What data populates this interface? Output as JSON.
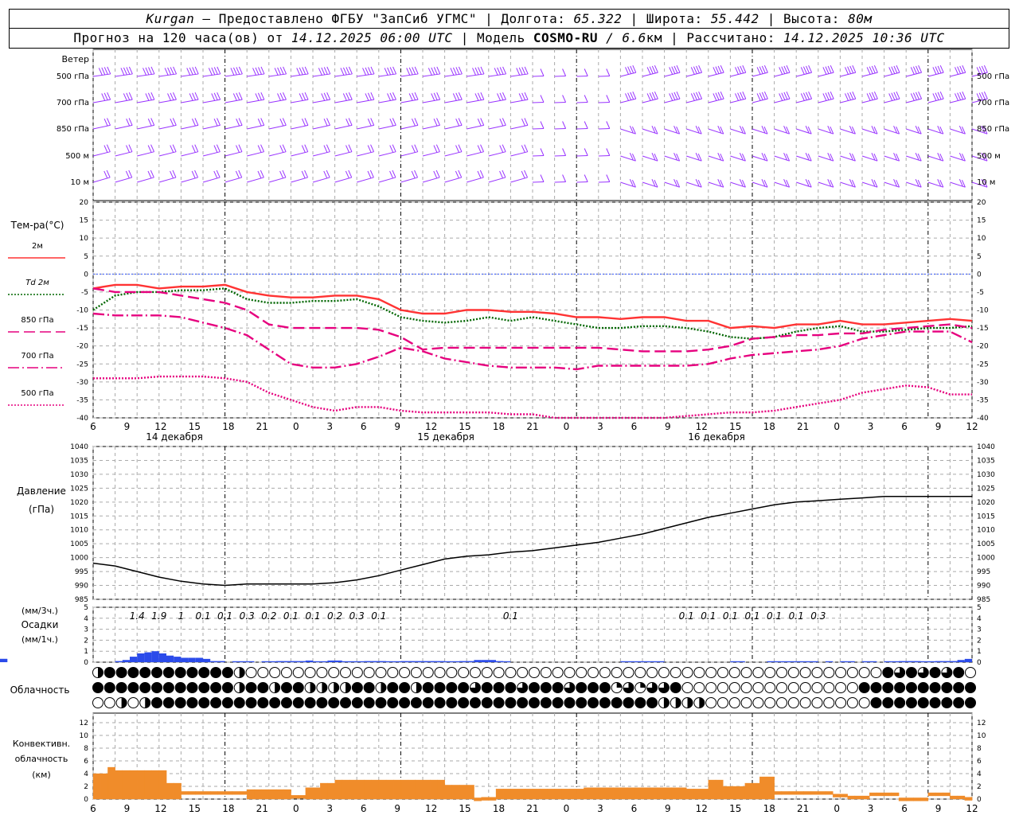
{
  "header": {
    "city": "Kurgan",
    "sep1": " — Предоставлено ФГБУ \"ЗапСиб УГМС\" | Долгота: ",
    "lon": "65.322",
    "sep2": " | Широта: ",
    "lat": "55.442",
    "sep3": " | Высота: ",
    "alt": "80м",
    "fc_prefix": "Прогноз на 120 часа(ов) от ",
    "fc_time": "14.12.2025 06:00 UTC",
    "model_prefix": " | Модель ",
    "model": "COSMO-RU",
    "res": " / 6.6",
    "res_unit": "км",
    "calc_prefix": " | Рассчитано: ",
    "calc_time": "14.12.2025 10:36 UTC"
  },
  "wind_panel": {
    "title": "Ветер",
    "levels": [
      "500 гПа",
      "700 гПа",
      "850 гПа",
      "500 м",
      "10  м"
    ],
    "right_levels": [
      "500 гПа",
      "700 гПа",
      "850 гПа",
      "500 м",
      "10  м"
    ],
    "color": "#9933ff"
  },
  "temp_panel": {
    "title": "Тем-ра(°С)",
    "legend": [
      {
        "label": "2м",
        "color": "#ff3333",
        "dash": "solid"
      },
      {
        "label": "Td  2м",
        "color": "#006600",
        "dash": "dotted"
      },
      {
        "label": "850 гПа",
        "color": "#e6007e",
        "dash": "dash"
      },
      {
        "label": "700 гПа",
        "color": "#e6007e",
        "dash": "dashdot"
      },
      {
        "label": "500 гПа",
        "color": "#e6007e",
        "dash": "dotted"
      }
    ],
    "yticks": [
      "20",
      "15",
      "10",
      "5",
      "0",
      "-5",
      "-10",
      "-15",
      "-20",
      "-25",
      "-30",
      "-35",
      "-40"
    ]
  },
  "x_axis": {
    "hour_labels": [
      "6",
      "9",
      "12",
      "15",
      "18",
      "21",
      "0",
      "3",
      "6",
      "9",
      "12",
      "15",
      "18",
      "21",
      "0",
      "3",
      "6",
      "9",
      "12",
      "15",
      "18",
      "21",
      "0",
      "3",
      "6",
      "9",
      "12"
    ],
    "dates": [
      "14 декабря",
      "15 декабря",
      "16 декабря"
    ]
  },
  "pressure_panel": {
    "title": "Давление",
    "unit": "(гПа)",
    "yticks": [
      "1040",
      "1035",
      "1030",
      "1025",
      "1020",
      "1015",
      "1010",
      "1005",
      "1000",
      "995",
      "990",
      "985"
    ]
  },
  "precip_panel": {
    "unit3h": "(мм/3ч.)",
    "title": "Осадки",
    "unit1h": "(мм/1ч.)",
    "yticks": [
      "5",
      "4",
      "3",
      "2",
      "1",
      "0"
    ],
    "color": "#2b4bea"
  },
  "cloud_panel": {
    "title": "Облачность"
  },
  "conv_panel": {
    "title1": "Конвективн.",
    "title2": "облачность",
    "unit": "(км)",
    "yticks": [
      "12",
      "10",
      "8",
      "6",
      "4",
      "2",
      "0"
    ],
    "color": "#f08c2a"
  },
  "chart_data": [
    {
      "type": "line",
      "title": "Тем-ра(°С)",
      "x_hours_from_start": [
        0,
        3,
        6,
        9,
        12,
        15,
        18,
        21,
        24,
        27,
        30,
        33,
        36,
        39,
        42,
        45,
        48,
        51,
        54,
        57,
        60,
        63,
        66,
        69,
        72,
        75,
        78,
        81,
        84,
        87,
        90,
        93,
        96,
        99,
        102,
        105,
        108,
        111,
        114,
        117,
        120
      ],
      "ylim": [
        -40,
        20
      ],
      "series": [
        {
          "name": "2м",
          "values": [
            -4,
            -3,
            -3,
            -4,
            -3.5,
            -3.5,
            -3,
            -5,
            -6,
            -6.5,
            -6.5,
            -6,
            -6,
            -7,
            -10,
            -11,
            -11,
            -10,
            -10,
            -10.5,
            -10.5,
            -11,
            -12,
            -12,
            -12.5,
            -12,
            -12,
            -13,
            -13,
            -15,
            -14.5,
            -15,
            -14,
            -14,
            -13,
            -14,
            -14,
            -13.5,
            -13,
            -12.5,
            -13
          ]
        },
        {
          "name": "Td  2м",
          "values": [
            -10,
            -6,
            -5,
            -5,
            -4.5,
            -4.5,
            -4,
            -7,
            -8,
            -8,
            -7.5,
            -7.5,
            -7,
            -9,
            -12,
            -13,
            -13.5,
            -13,
            -12,
            -13,
            -12,
            -13,
            -14,
            -15,
            -15,
            -14.5,
            -14.5,
            -15,
            -16,
            -17.5,
            -18,
            -17.5,
            -16,
            -15,
            -14.5,
            -16,
            -16,
            -15.5,
            -15,
            -15,
            -14.5
          ]
        },
        {
          "name": "850 гПа",
          "values": [
            -4,
            -5,
            -5,
            -5,
            -6,
            -7,
            -8,
            -10,
            -14,
            -15,
            -15,
            -15,
            -15,
            -15.5,
            -17.5,
            -21,
            -20.5,
            -20.5,
            -20.5,
            -20.5,
            -20.5,
            -20.5,
            -20.5,
            -20.5,
            -21,
            -21.5,
            -21.5,
            -21.5,
            -21,
            -20,
            -18,
            -17.5,
            -17,
            -17,
            -16.5,
            -16.5,
            -15.5,
            -15,
            -14.5,
            -14,
            -15
          ]
        },
        {
          "name": "700 гПа",
          "values": [
            -11,
            -11.5,
            -11.5,
            -11.5,
            -12,
            -13.5,
            -15,
            -17,
            -21,
            -25,
            -26,
            -26,
            -25,
            -23,
            -20.5,
            -21.5,
            -23.5,
            -24.5,
            -25.5,
            -26,
            -26,
            -26,
            -26.5,
            -25.5,
            -25.5,
            -25.5,
            -25.5,
            -25.5,
            -25,
            -23.5,
            -22.5,
            -22,
            -21.5,
            -21,
            -20,
            -18,
            -17,
            -16,
            -16,
            -16,
            -19
          ]
        },
        {
          "name": "500 гПа",
          "values": [
            -29,
            -29,
            -29,
            -28.5,
            -28.5,
            -28.5,
            -29,
            -30,
            -33,
            -35,
            -37,
            -38,
            -37,
            -37,
            -38,
            -38.5,
            -38.5,
            -38.5,
            -38.5,
            -39,
            -39,
            -40,
            -41,
            -42,
            -43,
            -42,
            -40,
            -39.5,
            -39,
            -38.5,
            -38.5,
            -38,
            -37,
            -36,
            -35,
            -33,
            -32,
            -31,
            -31.5,
            -33.5,
            -33.5
          ]
        }
      ]
    },
    {
      "type": "line",
      "title": "Давление",
      "x_hours_from_start": [
        0,
        3,
        6,
        9,
        12,
        15,
        18,
        21,
        24,
        27,
        30,
        33,
        36,
        39,
        42,
        45,
        48,
        51,
        54,
        57,
        60,
        63,
        66,
        69,
        72,
        75,
        78,
        81,
        84,
        87,
        90,
        93,
        96,
        99,
        102,
        105,
        108,
        111,
        114,
        117,
        120
      ],
      "ylim": [
        985,
        1040
      ],
      "series": [
        {
          "name": "Давление",
          "values": [
            998,
            997,
            995,
            993,
            991.5,
            990.5,
            990,
            990.5,
            990.5,
            990.5,
            990.5,
            991,
            992,
            993.5,
            995.5,
            997.5,
            999.5,
            1000.5,
            1001,
            1002,
            1002.5,
            1003.5,
            1004.5,
            1005.5,
            1007,
            1008.5,
            1010.5,
            1012.5,
            1014.5,
            1016,
            1017.5,
            1019,
            1020,
            1020.5,
            1021,
            1021.5,
            1022,
            1022,
            1022,
            1022,
            1022
          ]
        }
      ]
    },
    {
      "type": "bar",
      "title": "Осадки",
      "x_hours_from_start_1h": [
        0,
        1,
        2,
        3,
        4,
        5,
        6,
        7,
        8,
        9,
        10,
        11,
        12,
        13,
        14,
        15,
        16,
        17,
        18,
        19,
        20,
        21,
        22,
        23,
        24,
        25,
        26,
        27,
        28,
        29,
        30,
        31,
        32,
        33,
        34,
        35,
        36,
        37,
        38,
        39,
        40,
        41,
        42,
        43,
        44,
        45,
        46,
        47,
        48,
        49,
        50,
        51,
        52,
        53,
        54,
        55,
        56,
        57,
        58,
        59,
        60,
        61,
        62,
        63,
        64,
        65,
        66,
        67,
        68,
        69,
        70,
        71,
        72,
        73,
        74,
        75,
        76,
        77,
        78,
        79,
        80,
        81,
        82,
        83,
        84,
        85,
        86,
        87,
        88,
        89,
        90,
        91,
        92,
        93,
        94,
        95,
        96,
        97,
        98,
        99,
        100,
        101,
        102,
        103,
        104,
        105,
        106,
        107,
        108,
        109,
        110,
        111,
        112,
        113,
        114,
        115,
        116,
        117,
        118,
        119
      ],
      "values_1h": [
        0,
        0,
        0,
        0.1,
        0.2,
        0.5,
        0.8,
        0.9,
        1.0,
        0.8,
        0.6,
        0.5,
        0.4,
        0.4,
        0.4,
        0.3,
        0.1,
        0.1,
        0,
        0.05,
        0.05,
        0.05,
        0,
        0.05,
        0.05,
        0.1,
        0.1,
        0.1,
        0.1,
        0.15,
        0.05,
        0.05,
        0.15,
        0.15,
        0.05,
        0.05,
        0.05,
        0.1,
        0.1,
        0.1,
        0.05,
        0.05,
        0.1,
        0.1,
        0.1,
        0.1,
        0.1,
        0.1,
        0.05,
        0.05,
        0.1,
        0.1,
        0.2,
        0.2,
        0.2,
        0.1,
        0.05,
        0,
        0,
        0,
        0,
        0,
        0,
        0,
        0,
        0,
        0,
        0,
        0,
        0,
        0,
        0,
        0.05,
        0.05,
        0.05,
        0.05,
        0.05,
        0.05,
        0,
        0,
        0,
        0,
        0,
        0,
        0,
        0,
        0,
        0.05,
        0.05,
        0,
        0,
        0,
        0.05,
        0.05,
        0.05,
        0.05,
        0.05,
        0.05,
        0.05,
        0,
        0.05,
        0,
        0.05,
        0.05,
        0,
        0.05,
        0.05,
        0,
        0.05,
        0.05,
        0.1,
        0.1,
        0.1,
        0.05,
        0.05,
        0.1,
        0.1,
        0.1,
        0.2,
        0.3,
        0.3,
        0.3
      ],
      "labels_3h": [
        {
          "x": 6,
          "text": "1.4"
        },
        {
          "x": 9,
          "text": "1.9"
        },
        {
          "x": 12,
          "text": "1"
        },
        {
          "x": 15,
          "text": "0.1"
        },
        {
          "x": 18,
          "text": "0.1"
        },
        {
          "x": 21,
          "text": "0.3"
        },
        {
          "x": 24,
          "text": "0.2"
        },
        {
          "x": 27,
          "text": "0.1"
        },
        {
          "x": 30,
          "text": "0.1"
        },
        {
          "x": 33,
          "text": "0.2"
        },
        {
          "x": 36,
          "text": "0.3"
        },
        {
          "x": 39,
          "text": "0.1"
        },
        {
          "x": 57,
          "text": "0.1"
        },
        {
          "x": 81,
          "text": "0.1"
        },
        {
          "x": 84,
          "text": "0.1"
        },
        {
          "x": 87,
          "text": "0.1"
        },
        {
          "x": 90,
          "text": "0.1"
        },
        {
          "x": 93,
          "text": "0.1"
        },
        {
          "x": 96,
          "text": "0.1"
        },
        {
          "x": 99,
          "text": "0.3"
        }
      ],
      "ylim": [
        0,
        5
      ]
    },
    {
      "type": "bar",
      "title": "Конвективн. облачность",
      "x_hours_from_start_1h": [
        0,
        1,
        2,
        3,
        4,
        5,
        6,
        7,
        8,
        9,
        10,
        11,
        12,
        13,
        14,
        15,
        16,
        17,
        18,
        19,
        20,
        21,
        22,
        23,
        24,
        25,
        26,
        27,
        28,
        29,
        30,
        31,
        32,
        33,
        34,
        35,
        36,
        37,
        38,
        39,
        40,
        41,
        42,
        43,
        44,
        45,
        46,
        47,
        48,
        49,
        50,
        51,
        52,
        53,
        54,
        55,
        56,
        57,
        58,
        59,
        60,
        61,
        62,
        63,
        64,
        65,
        66,
        67,
        68,
        69,
        70,
        71,
        72,
        73,
        74,
        75,
        76,
        77,
        78,
        79,
        80,
        81,
        82,
        83,
        84,
        85,
        86,
        87,
        88,
        89,
        90,
        91,
        92,
        93,
        94,
        95,
        96,
        97,
        98,
        99,
        100,
        101,
        102,
        103,
        104,
        105,
        106,
        107,
        108,
        109,
        110,
        111,
        112,
        113,
        114,
        115,
        116,
        117,
        118,
        119
      ],
      "bottom_km": [
        0,
        0,
        0,
        0,
        0,
        0,
        0,
        0,
        0,
        0,
        0,
        0,
        0,
        0,
        0,
        0,
        0,
        0,
        0,
        0,
        0,
        0,
        0,
        0,
        0,
        0,
        0,
        0,
        0,
        0,
        0,
        0,
        0,
        0,
        0,
        0,
        0,
        0,
        0,
        0,
        0,
        0,
        0,
        0,
        0,
        0,
        0,
        0,
        0,
        0,
        0,
        0,
        0,
        0,
        0,
        0,
        0,
        0,
        0,
        0,
        0,
        0,
        0,
        0,
        0,
        0,
        0,
        0,
        0,
        0,
        0,
        0,
        0,
        0,
        0,
        0,
        0,
        0,
        0,
        0,
        0,
        0,
        0,
        0,
        0,
        0,
        0,
        0,
        0,
        0,
        0,
        0,
        0,
        0,
        0,
        0,
        0,
        0,
        0,
        0,
        0,
        0,
        0,
        0,
        0,
        0,
        0,
        0,
        0,
        0,
        0,
        0,
        0,
        0,
        0,
        0,
        0,
        0,
        0,
        0
      ],
      "top_km": [
        4,
        4,
        5,
        4.5,
        4.5,
        4.5,
        4.5,
        4.5,
        4.5,
        4.5,
        2.5,
        2.5,
        1.2,
        1.2,
        1.2,
        1.2,
        1.2,
        1.2,
        1.2,
        1.2,
        1.2,
        1.5,
        1.5,
        1.5,
        1.5,
        1.5,
        1.5,
        0.6,
        0.6,
        1.8,
        1.8,
        2.5,
        2.5,
        3,
        3,
        3,
        3,
        3,
        3,
        3,
        3,
        3,
        3,
        3,
        3,
        3,
        3,
        3,
        2.2,
        2.2,
        2.2,
        2.2,
        0.2,
        0.3,
        0.3,
        1.6,
        1.6,
        1.6,
        1.6,
        1.6,
        1.6,
        1.6,
        1.6,
        1.6,
        1.6,
        1.6,
        1.6,
        1.8,
        1.8,
        1.8,
        1.8,
        1.8,
        1.8,
        1.8,
        1.8,
        1.8,
        1.8,
        1.8,
        1.8,
        1.8,
        1.8,
        1.6,
        1.6,
        1.6,
        3,
        3,
        2,
        2,
        2,
        2.5,
        2.5,
        3.5,
        3.5,
        1.2,
        1.2,
        1.2,
        1.2,
        1.2,
        1.2,
        1.2,
        1.2,
        0.8,
        0.8,
        0.5,
        0.5,
        0.5,
        1,
        1,
        1,
        1,
        0.2,
        0.2,
        0.2,
        0.2,
        1,
        1,
        1,
        0.5,
        0.5,
        0.3
      ]
    }
  ]
}
